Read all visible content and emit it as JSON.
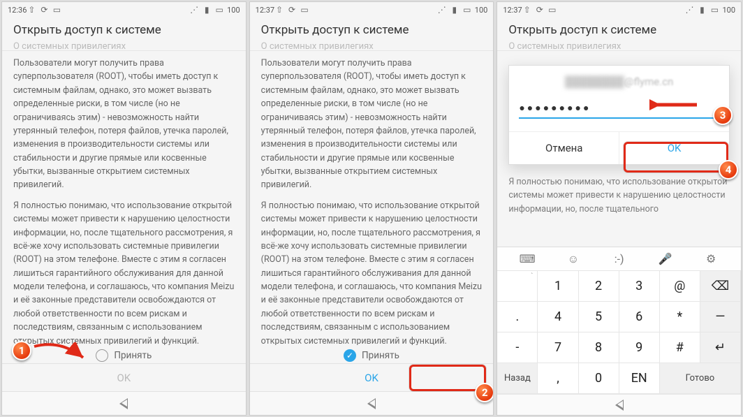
{
  "status": {
    "time1": "12:36",
    "time2": "12:37",
    "time3": "12:37",
    "battery": "100"
  },
  "header": {
    "title": "Открыть доступ к системе"
  },
  "subtitle_faded": "О системных привилегиях",
  "para1": "Пользователи могут получить права суперпользователя (ROOT), чтобы иметь доступ к системным файлам, однако, это может вызвать определенные риски, в том числе (но не ограничиваясь этим) - невозможность найти утерянный телефон, потеря файлов, утечка паролей, изменения в производительности системы или стабильности и другие прямые или косвенные убытки, вызванные открытием системных привилегий.",
  "para2": "Я полностью понимаю, что использование открытой системы может привести к нарушению целостности информации, но, после тщательного рассмотрения, я всё-же хочу использовать системные привилегии (ROOT) на этом телефоне. Вместе с этим я согласен лишиться гарантийного обслуживания для данной модели телефона, и соглашаюсь, что компания Meizu и её законные представители освобождаются от любой ответственности по всем рискам и последствиям, связанным с использованием открытых системных привилегий и функций.",
  "para2_short": "Я полностью понимаю, что использование открытой системы может привести к нарушению целостности информации, но, после тщательного",
  "accept": {
    "label": "Принять"
  },
  "footer": {
    "ok": "OK"
  },
  "dialog": {
    "email_visible": "@flyme.cn",
    "password_masked": "●●●●●●●●●",
    "cancel": "Отмена",
    "ok": "OK"
  },
  "keyboard": {
    "toolbar": [
      "⌨",
      "☺",
      ":-)",
      "🎤",
      "⚙"
    ],
    "rows": [
      [
        {
          "s": "`",
          "m": ""
        },
        {
          "s": "",
          "m": "1"
        },
        {
          "s": "",
          "m": "2"
        },
        {
          "s": "",
          "m": "3"
        },
        {
          "s": "",
          "m": "@"
        },
        {
          "s": "",
          "m": "⌫",
          "g": true
        }
      ],
      [
        {
          "s": "",
          "m": "."
        },
        {
          "s": "",
          "m": "4"
        },
        {
          "s": "",
          "m": "5"
        },
        {
          "s": "",
          "m": "6"
        },
        {
          "s": "",
          "m": "*"
        },
        {
          "s": "",
          "m": "—",
          "g": true
        }
      ],
      [
        {
          "s": "",
          "m": "-"
        },
        {
          "s": "",
          "m": "7"
        },
        {
          "s": "",
          "m": "8"
        },
        {
          "s": "",
          "m": "9"
        },
        {
          "s": "",
          "m": "#"
        },
        {
          "s": "",
          "m": "↵",
          "g": true
        }
      ],
      [
        {
          "s": "",
          "m": "Назад",
          "g": true,
          "w": true
        },
        {
          "s": "",
          "m": ","
        },
        {
          "s": "",
          "m": "0"
        },
        {
          "s": "",
          "m": "EN"
        },
        {
          "s": "",
          "m": "Готово",
          "g": true,
          "w": true
        }
      ]
    ]
  },
  "markers": {
    "m1": "1",
    "m2": "2",
    "m3": "3",
    "m4": "4"
  }
}
